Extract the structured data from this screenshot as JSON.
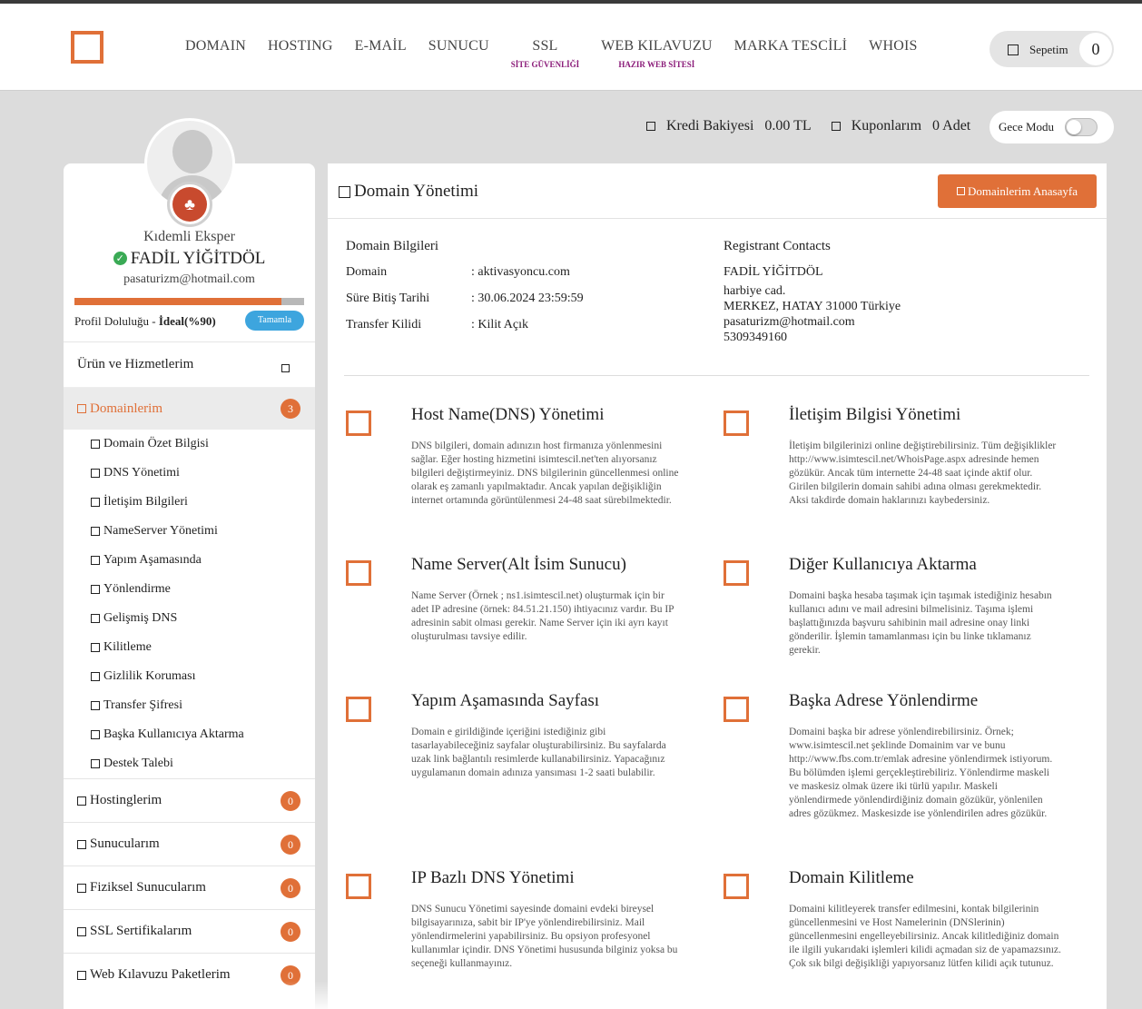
{
  "header": {
    "nav": [
      {
        "label": "DOMAIN",
        "sub": ""
      },
      {
        "label": "HOSTING",
        "sub": ""
      },
      {
        "label": "E-MAİL",
        "sub": ""
      },
      {
        "label": "SUNUCU",
        "sub": ""
      },
      {
        "label": "SSL",
        "sub": "SİTE GÜVENLİĞİ"
      },
      {
        "label": "WEB KILAVUZU",
        "sub": "HAZIR WEB SİTESİ"
      },
      {
        "label": "MARKA TESCİLİ",
        "sub": ""
      },
      {
        "label": "WHOIS",
        "sub": ""
      }
    ],
    "cart_label": "Sepetim",
    "cart_count": "0"
  },
  "status": {
    "credit_label": "Kredi Bakiyesi",
    "credit_value": "0.00 TL",
    "coupons_label": "Kuponlarım",
    "coupons_value": "0 Adet",
    "night_mode_label": "Gece Modu"
  },
  "profile": {
    "rank": "Kıdemli Eksper",
    "name": "FADİL YİĞİTDÖL",
    "email": "pasaturizm@hotmail.com",
    "completion_prefix": "Profil Doluluğu - ",
    "completion_value": "İdeal(%90)",
    "completion_fraction": 0.9,
    "complete_button": "Tamamla"
  },
  "menu": {
    "header": "Ürün ve Hizmetlerim",
    "active": {
      "label": "Domainlerim",
      "count": "3"
    },
    "sub_items": [
      "Domain Özet Bilgisi",
      "DNS Yönetimi",
      "İletişim Bilgileri",
      "NameServer Yönetimi",
      "Yapım Aşamasında",
      "Yönlendirme",
      "Gelişmiş DNS",
      "Kilitleme",
      "Gizlilik Koruması",
      "Transfer Şifresi",
      "Başka Kullanıcıya Aktarma",
      "Destek Talebi"
    ],
    "groups": [
      {
        "label": "Hostinglerim",
        "count": "0"
      },
      {
        "label": "Sunucularım",
        "count": "0"
      },
      {
        "label": "Fiziksel Sunucularım",
        "count": "0"
      },
      {
        "label": "SSL Sertifikalarım",
        "count": "0"
      },
      {
        "label": "Web Kılavuzu Paketlerim",
        "count": "0"
      }
    ]
  },
  "main": {
    "title": "Domain Yönetimi",
    "home_button": "Domainlerim Anasayfa",
    "info_title": "Domain Bilgileri",
    "info_rows": [
      {
        "label": "Domain",
        "value": ": aktivasyoncu.com"
      },
      {
        "label": "Süre Bitiş Tarihi",
        "value": ": 30.06.2024 23:59:59"
      },
      {
        "label": "Transfer Kilidi",
        "value": ": Kilit Açık"
      }
    ],
    "contacts_title": "Registrant Contacts",
    "contacts": [
      "FADİL YİĞİTDÖL",
      "harbiye cad.",
      "MERKEZ, HATAY 31000 Türkiye",
      "pasaturizm@hotmail.com",
      "5309349160"
    ],
    "features": [
      {
        "title": "Host Name(DNS) Yönetimi",
        "desc": "DNS bilgileri, domain adınızın host firmanıza yönlenmesini sağlar. Eğer hosting hizmetini isimtescil.net'ten alıyorsanız bilgileri değiştirmeyiniz. DNS bilgilerinin güncellenmesi online olarak eş zamanlı yapılmaktadır. Ancak yapılan değişikliğin internet ortamında görüntülenmesi 24-48 saat sürebilmektedir."
      },
      {
        "title": "İletişim Bilgisi Yönetimi",
        "desc": "İletişim bilgilerinizi online değiştirebilirsiniz. Tüm değişiklikler http://www.isimtescil.net/WhoisPage.aspx adresinde hemen gözükür. Ancak tüm internette 24-48 saat içinde aktif olur. Girilen bilgilerin domain sahibi adına olması gerekmektedir. Aksi takdirde domain haklarınızı kaybedersiniz."
      },
      {
        "title": "Name Server(Alt İsim Sunucu)",
        "desc": "Name Server (Örnek ; ns1.isimtescil.net) oluşturmak için bir adet IP adresine (örnek: 84.51.21.150) ihtiyacınız vardır. Bu IP adresinin sabit olması gerekir. Name Server için iki ayrı kayıt oluşturulması tavsiye edilir."
      },
      {
        "title": "Diğer Kullanıcıya Aktarma",
        "desc": "Domaini başka hesaba taşımak için taşımak istediğiniz hesabın kullanıcı adını ve mail adresini bilmelisiniz. Taşıma işlemi başlattığınızda başvuru sahibinin mail adresine onay linki gönderilir. İşlemin tamamlanması için bu linke tıklamanız gerekir."
      },
      {
        "title": "Yapım Aşamasında Sayfası",
        "desc": "Domain e girildiğinde içeriğini istediğiniz gibi tasarlayabileceğiniz sayfalar oluşturabilirsiniz. Bu sayfalarda uzak link bağlantılı resimlerde kullanabilirsiniz. Yapacağınız uygulamanın domain adınıza yansıması 1-2 saati bulabilir."
      },
      {
        "title": "Başka Adrese Yönlendirme",
        "desc": "Domaini başka bir adrese yönlendirebilirsiniz. Örnek; www.isimtescil.net şeklinde Domainim var ve bunu http://www.fbs.com.tr/emlak adresine yönlendirmek istiyorum. Bu bölümden işlemi gerçekleştirebiliriz. Yönlendirme maskeli ve maskesiz olmak üzere iki türlü yapılır. Maskeli yönlendirmede yönlendirdiğiniz domain gözükür, yönlenilen adres gözükmez. Maskesizde ise yönlendirilen adres gözükür."
      },
      {
        "title": "IP Bazlı DNS Yönetimi",
        "desc": "DNS Sunucu Yönetimi sayesinde domaini evdeki bireysel bilgisayarınıza, sabit bir IP'ye yönlendirebilirsiniz. Mail yönlendirmelerini yapabilirsiniz. Bu opsiyon profesyonel kullanımlar içindir. DNS Yönetimi hususunda bilginiz yoksa bu seçeneği kullanmayınız."
      },
      {
        "title": "Domain Kilitleme",
        "desc": "Domaini kilitleyerek transfer edilmesini, kontak bilgilerinin güncellenmesini ve Host Namelerinin (DNSlerinin) güncellenmesini engelleyebilirsiniz. Ancak kilitlediğiniz domain ile ilgili yukarıdaki işlemleri kilidi açmadan siz de yapamazsınız. Çok sık bilgi değişikliği yapıyorsanız lütfen kilidi açık tutunuz."
      }
    ]
  }
}
